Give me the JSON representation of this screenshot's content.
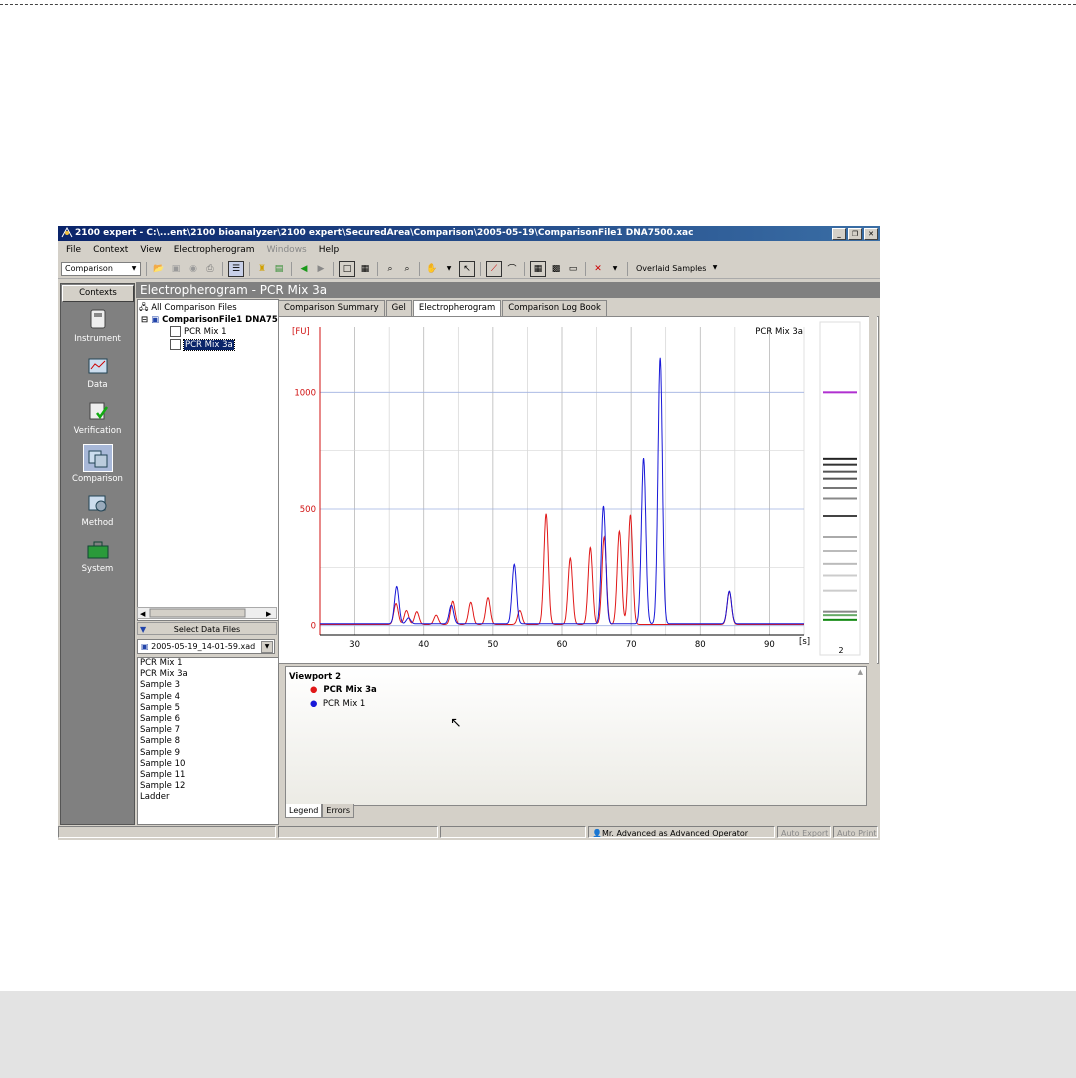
{
  "window": {
    "title": "2100 expert - C:\\...ent\\2100 bioanalyzer\\2100 expert\\SecuredArea\\Comparison\\2005-05-19\\ComparisonFile1 DNA7500.xac",
    "buttons": [
      "_",
      "❐",
      "✕"
    ]
  },
  "menu": {
    "items": [
      {
        "label": "File",
        "enabled": true
      },
      {
        "label": "Context",
        "enabled": true
      },
      {
        "label": "View",
        "enabled": true
      },
      {
        "label": "Electropherogram",
        "enabled": true
      },
      {
        "label": "Windows",
        "enabled": false
      },
      {
        "label": "Help",
        "enabled": true
      }
    ]
  },
  "toolbar": {
    "context_select": "Comparison",
    "overlay_select": "Overlaid Samples"
  },
  "contexts": {
    "header": "Contexts",
    "items": [
      "Instrument",
      "Data",
      "Verification",
      "Comparison",
      "Method",
      "System"
    ],
    "selected": "Comparison"
  },
  "header": {
    "title": "Electropherogram - PCR Mix 3a"
  },
  "tree": {
    "root": "All Comparison Files",
    "file": "ComparisonFile1 DNA75",
    "samples": [
      "PCR Mix 1",
      "PCR Mix 3a"
    ],
    "selected_sample": "PCR Mix 3a"
  },
  "select_files": {
    "label": "Select Data Files",
    "file": "2005-05-19_14-01-59.xad",
    "items": [
      "PCR Mix 1",
      "PCR Mix 3a",
      "Sample 3",
      "Sample 4",
      "Sample 5",
      "Sample 6",
      "Sample 7",
      "Sample 8",
      "Sample 9",
      "Sample 10",
      "Sample 11",
      "Sample 12",
      "Ladder"
    ]
  },
  "tabs": [
    "Comparison Summary",
    "Gel",
    "Electropherogram",
    "Comparison Log Book"
  ],
  "active_tab": "Electropherogram",
  "chart_data": {
    "type": "line",
    "title": "PCR Mix 3a",
    "ylabel": "[FU]",
    "xlabel": "[s]",
    "xlim": [
      25,
      95
    ],
    "ylim": [
      -40,
      1280
    ],
    "x_ticks": [
      30,
      40,
      50,
      60,
      70,
      80,
      90
    ],
    "y_ticks": [
      0,
      500,
      1000
    ],
    "grid": true,
    "series": [
      {
        "name": "PCR Mix 3a",
        "color": "#e01818",
        "peaks": [
          [
            36.0,
            90
          ],
          [
            37.5,
            60
          ],
          [
            39.0,
            55
          ],
          [
            41.8,
            40
          ],
          [
            44.2,
            100
          ],
          [
            46.8,
            95
          ],
          [
            49.3,
            115
          ],
          [
            53.9,
            60
          ],
          [
            57.7,
            475
          ],
          [
            61.2,
            285
          ],
          [
            64.1,
            330
          ],
          [
            66.1,
            375
          ],
          [
            68.3,
            400
          ],
          [
            69.9,
            470
          ],
          [
            84.2,
            140
          ]
        ]
      },
      {
        "name": "PCR Mix 1",
        "color": "#1818d8",
        "peaks": [
          [
            36.1,
            160
          ],
          [
            37.8,
            25
          ],
          [
            44.0,
            80
          ],
          [
            53.1,
            255
          ],
          [
            66.0,
            505
          ],
          [
            71.8,
            710
          ],
          [
            74.2,
            1140
          ],
          [
            84.2,
            140
          ]
        ]
      }
    ],
    "gel": {
      "lane_label": "2",
      "bands": [
        {
          "y_value": 1000,
          "color": "#b030d0"
        },
        {
          "y_value": 715,
          "color": "#222222"
        },
        {
          "y_value": 690,
          "color": "#333333"
        },
        {
          "y_value": 660,
          "color": "#555555"
        },
        {
          "y_value": 630,
          "color": "#555555"
        },
        {
          "y_value": 590,
          "color": "#777777"
        },
        {
          "y_value": 545,
          "color": "#888888"
        },
        {
          "y_value": 470,
          "color": "#444444"
        },
        {
          "y_value": 380,
          "color": "#aaaaaa"
        },
        {
          "y_value": 320,
          "color": "#bbbbbb"
        },
        {
          "y_value": 265,
          "color": "#bbbbbb"
        },
        {
          "y_value": 215,
          "color": "#cccccc"
        },
        {
          "y_value": 150,
          "color": "#cccccc"
        },
        {
          "y_value": 60,
          "color": "#888888"
        },
        {
          "y_value": 45,
          "color": "#66aa66"
        },
        {
          "y_value": 25,
          "color": "#118811"
        }
      ]
    }
  },
  "legend": {
    "title": "Viewport 2",
    "entries": [
      {
        "label": "PCR Mix 3a",
        "color": "#e01818",
        "bold": true
      },
      {
        "label": "PCR Mix 1",
        "color": "#1818d8",
        "bold": false
      }
    ]
  },
  "bottom_tabs": [
    "Legend",
    "Errors"
  ],
  "status": {
    "user": "Mr. Advanced as Advanced Operator",
    "auto_export": "Auto Export",
    "auto_print": "Auto Print"
  }
}
